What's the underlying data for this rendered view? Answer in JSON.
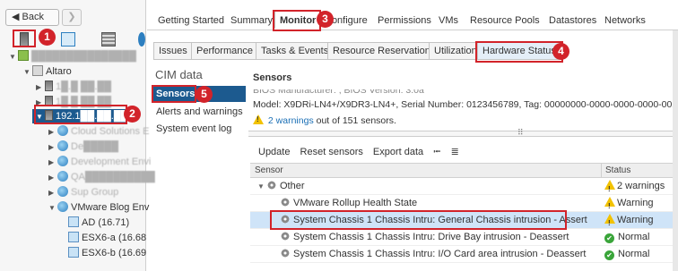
{
  "nav": {
    "back_label": "Back",
    "fwd_glyph": "❯",
    "icons": [
      "host-view-icon",
      "vm-view-icon",
      "storage-view-icon",
      "network-view-icon"
    ]
  },
  "tree": [
    {
      "label": "",
      "icon": "datacenter-icon",
      "blurred": true
    },
    {
      "label": "Altaro",
      "icon": "datacenter-icon",
      "blurred": false
    },
    {
      "label": "1█.█ ██.██",
      "icon": "host-icon",
      "blurred": true
    },
    {
      "label": "1█.█ ██.██",
      "icon": "host-icon",
      "blurred": true
    },
    {
      "label": "192.1██.██.███",
      "icon": "host-icon",
      "blurred": false,
      "selected": true
    },
    {
      "label": "Cloud Solutions E",
      "icon": "vapp-icon",
      "blurred": true
    },
    {
      "label": "De█████",
      "icon": "vapp-icon",
      "blurred": true
    },
    {
      "label": "Development Envi",
      "icon": "vapp-icon",
      "blurred": true
    },
    {
      "label": "QA██████████",
      "icon": "vapp-icon",
      "blurred": true
    },
    {
      "label": "Sup Group",
      "icon": "vapp-icon",
      "blurred": true
    },
    {
      "label": "VMware Blog Env",
      "icon": "vapp-icon",
      "blurred": false
    },
    {
      "label": "AD (16.71)",
      "icon": "vm-icon",
      "blurred": false
    },
    {
      "label": "ESX6-a (16.68",
      "icon": "vm-icon",
      "blurred": false
    },
    {
      "label": "ESX6-b (16.69",
      "icon": "vm-icon",
      "blurred": false
    }
  ],
  "top_tabs": [
    "Getting Started",
    "Summary",
    "Monitor",
    "Configure",
    "Permissions",
    "VMs",
    "Resource Pools",
    "Datastores",
    "Networks"
  ],
  "sub_tabs": [
    "Issues",
    "Performance",
    "Tasks & Events",
    "Resource Reservation",
    "Utilization",
    "Hardware Status"
  ],
  "cim": {
    "title": "CIM data",
    "items": [
      "Sensors",
      "Alerts and warnings",
      "System event log"
    ]
  },
  "sensors": {
    "title": "Sensors",
    "bios_line": "BIOS Manufacturer: , BIOS Version: 3.0a",
    "model_line": "Model:  X9DRi-LN4+/X9DR3-LN4+,  Serial Number:  0123456789,  Tag:  00000000-0000-0000-0000-002",
    "warnings_link": "2 warnings",
    "warnings_rest": "out of 151 sensors.",
    "toolbar": {
      "update": "Update",
      "reset": "Reset sensors",
      "export": "Export data"
    },
    "columns": {
      "sensor": "Sensor",
      "status": "Status"
    },
    "rows": [
      {
        "name": "Other",
        "status": "2 warnings",
        "level": 0,
        "status_icon": "warning-icon"
      },
      {
        "name": "VMware Rollup Health State",
        "status": "Warning",
        "level": 1,
        "status_icon": "warning-icon"
      },
      {
        "name": "System Chassis 1 Chassis Intru: General Chassis intrusion - Assert",
        "status": "Warning",
        "level": 1,
        "status_icon": "warning-icon",
        "highlight": true
      },
      {
        "name": "System Chassis 1 Chassis Intru: Drive Bay intrusion - Deassert",
        "status": "Normal",
        "level": 1,
        "status_icon": "normal-icon"
      },
      {
        "name": "System Chassis 1 Chassis Intru: I/O Card area intrusion - Deassert",
        "status": "Normal",
        "level": 1,
        "status_icon": "normal-icon"
      }
    ]
  },
  "callouts": [
    "1",
    "2",
    "3",
    "4",
    "5"
  ],
  "colors": {
    "callout": "#d2232a",
    "selection": "#1c5a8f",
    "row_highlight": "#cfe4f8"
  }
}
